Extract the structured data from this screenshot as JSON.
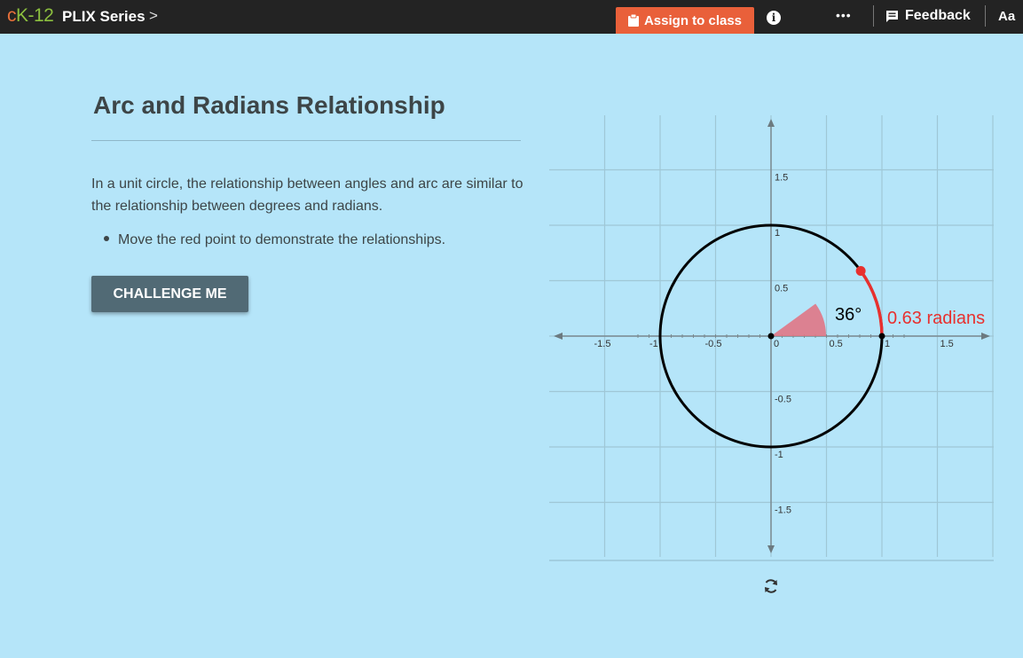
{
  "header": {
    "logo_c": "c",
    "logo_k": "K-12",
    "series_label": "PLIX Series",
    "chevron": ">",
    "assign_label": "Assign to class",
    "info_label": "i",
    "more_label": "•••",
    "feedback_label": "Feedback",
    "font_label": "Aa"
  },
  "content": {
    "title": "Arc and Radians Relationship",
    "description": "In a unit circle, the relationship between angles and arc are similar to the relationship between degrees and radians.",
    "bullet": "Move the red point to demonstrate the relationships.",
    "challenge_label": "CHALLENGE ME"
  },
  "graph": {
    "angle_label": "36°",
    "radians_label": "0.63 radians",
    "angle_degrees": 36,
    "x_ticks": [
      "-1.5",
      "-1",
      "-0.5",
      "0",
      "0.5",
      "1",
      "1.5"
    ],
    "y_ticks": [
      "1.5",
      "1",
      "0.5",
      "-0.5",
      "-1",
      "-1.5"
    ]
  },
  "colors": {
    "background": "#b5e5f9",
    "header": "#232323",
    "accent": "#e9603a",
    "button": "#516a75",
    "arc": "#e8302e",
    "sector": "#e07685"
  },
  "icons": [
    "clipboard-icon",
    "info-icon",
    "more-icon",
    "feedback-icon",
    "reset-icon"
  ]
}
